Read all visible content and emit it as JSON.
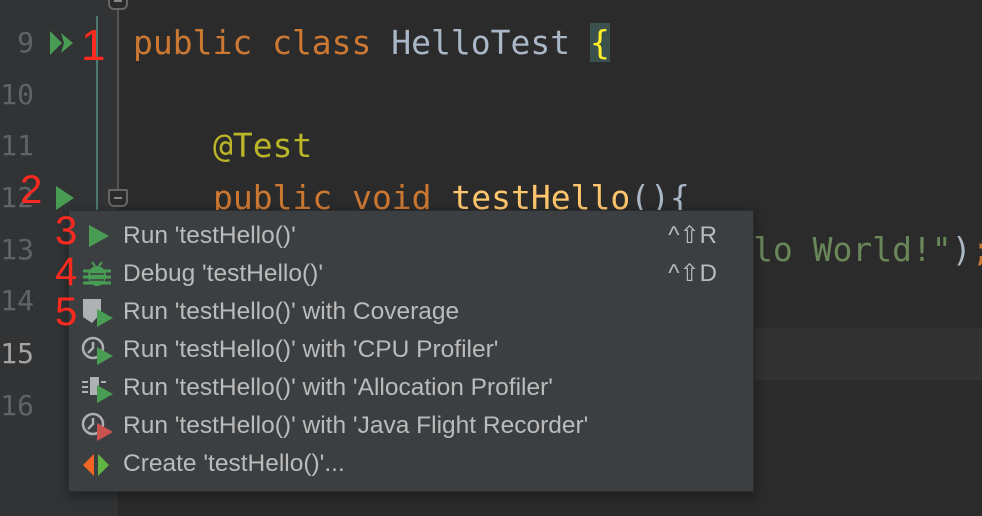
{
  "editor": {
    "line_numbers": [
      "9",
      "10",
      "11",
      "12",
      "13",
      "14",
      "15",
      "16"
    ],
    "current_line": "15",
    "code": {
      "l9_kw": "public class ",
      "l9_cls": "HelloTest ",
      "l9_brace": "{",
      "l11_ann": "@Test",
      "l12_kw": "public void ",
      "l12_fn": "testHello",
      "l12_par": "(){",
      "l13_str": "lo World!\"",
      "l13_par": ")",
      "l13_semi": ";"
    }
  },
  "annotations": [
    "1",
    "2",
    "3",
    "4",
    "5"
  ],
  "gutter_icons": {
    "line9": "run-all-icon",
    "line12": "run-icon"
  },
  "menu": {
    "items": [
      {
        "label": "Run 'testHello()'",
        "shortcut": "^⇧R",
        "icon": "run-icon"
      },
      {
        "label": "Debug 'testHello()'",
        "shortcut": "^⇧D",
        "icon": "debug-icon"
      },
      {
        "label": "Run 'testHello()' with Coverage",
        "icon": "coverage-icon"
      },
      {
        "label": "Run 'testHello()' with 'CPU Profiler'",
        "icon": "cpu-profiler-icon"
      },
      {
        "label": "Run 'testHello()' with 'Allocation Profiler'",
        "icon": "allocation-profiler-icon"
      },
      {
        "label": "Run 'testHello()' with 'Java Flight Recorder'",
        "icon": "flight-recorder-icon"
      },
      {
        "label": "Create 'testHello()'...",
        "icon": "create-config-icon"
      }
    ]
  },
  "colors": {
    "run": "#499c54",
    "recorder": "#c75450",
    "annotation": "#ff2a1f",
    "menu_bg": "#3c3f41"
  }
}
